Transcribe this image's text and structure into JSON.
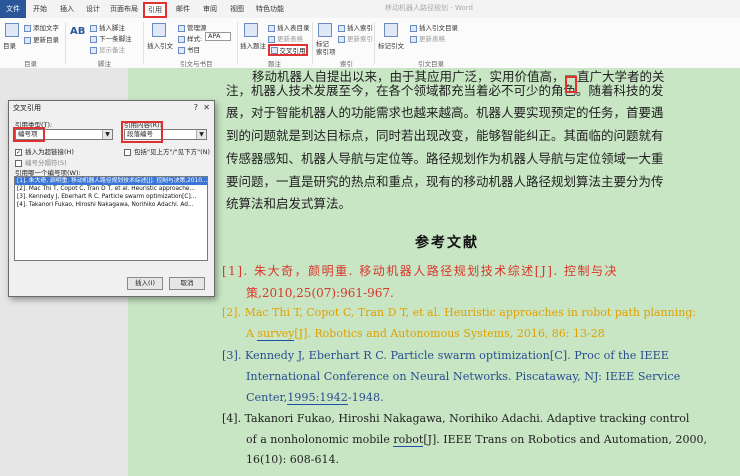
{
  "tabs": {
    "file": "文件",
    "home": "开始",
    "insert": "插入",
    "design": "设计",
    "layout": "页面布局",
    "references": "引用",
    "mailings": "邮件",
    "review": "审阅",
    "view": "视图",
    "special": "特色功能"
  },
  "window_title": "移动机器人路径规划 - Word",
  "ribbon": {
    "toc_label": "目录",
    "add_text": "添加文字",
    "update_toc": "更新目录",
    "insert_footnote": "插入脚注",
    "next_footnote": "下一条脚注",
    "show_notes": "显示备注",
    "ab_label": "AB",
    "insert_citation": "插入引文",
    "manage_sources": "管理源",
    "style_label": "样式:",
    "style_value": "APA",
    "bibliography": "书目",
    "insert_caption": "插入题注",
    "insert_table_of_figures": "插入表目录",
    "update_table": "更新表格",
    "cross_reference": "交叉引用",
    "mark_entry": "标记\n索引项",
    "insert_index": "插入索引",
    "update_index": "更新索引",
    "mark_citation": "标记引文",
    "insert_toa": "插入引文目录",
    "update_toa": "更新表格",
    "group_toc": "目录",
    "group_footnotes": "脚注",
    "group_citations": "引文与书目",
    "group_captions": "题注",
    "group_index": "索引",
    "group_toa": "引文目录"
  },
  "document": {
    "body_lines": [
      "移动机器人自提出以来，由于其应用广泛，实用价值高，一直广大学者的关",
      "注，机器人技术发展至今，在各个领域都充当着必不可少的角色。随着科技的发",
      "展，对于智能机器人的功能需求也越来越高。机器人要实现预定的任务，首要遇",
      "到的问题就是到达目标点，同时若出现改变，能够智能纠正。其面临的问题就有",
      "传感器感知、机器人导航与定位等。路径规划作为机器人导航与定位领域一大重",
      "要问题，一直是研究的热点和重点，现有的移动机器人路径规划算法主要分为传",
      "统算法和启发式算法。"
    ],
    "references_title": "参考文献",
    "refs": [
      {
        "line1": "[1]. 朱大奇，颜明重. 移动机器人路径规划技术综述[J]. 控制与决",
        "line2": "策,2010,25(07):961-967."
      },
      {
        "line1": "[2]. Mac Thi T, Copot C, Tran D T, et al. Heuristic approaches in robot path planning:",
        "line2a": "A ",
        "line2b": "survey",
        "line2c": "[J]. Robotics and Autonomous Systems, 2016, 86: 13-28"
      },
      {
        "line1": "[3]. Kennedy J, Eberhart R C. Particle swarm optimization[C]. Proc of the IEEE",
        "line2": "International Conference on Neural Networks. Piscataway, NJ: IEEE Service",
        "line3a": "Center,",
        "line3b": "1995:1942",
        "line3c": "-1948."
      },
      {
        "line1": "[4]. Takanori Fukao, Hiroshi Nakagawa, Norihiko Adachi. Adaptive tracking control",
        "line2a": "of a nonholonomic mobile ",
        "line2b": "robot",
        "line2c": "[J]. IEEE Trans on Robotics and Automation, 2000,",
        "line3": "16(10): 608-614."
      }
    ]
  },
  "dialog": {
    "title": "交叉引用",
    "help": "?",
    "close": "✕",
    "ref_type_label": "引用类型(T):",
    "ref_type_value": "编号项",
    "ref_content_label": "引用内容(R):",
    "ref_content_value": "段落编号",
    "insert_hyperlink": "插入为超链接(H)",
    "include_above_below": "包括\"见上方\"/\"见下方\"(N)",
    "separate_numbers": "编号分隔符(S)",
    "which_item_label": "引用哪一个编号项(W):",
    "items": [
      "[1]. 朱大奇, 颜明重. 移动机器人路径规划技术综述[J]. 控制与决策,2010...",
      "[2]. Mac Thi T, Copot C, Tran D T, et al. Heuristic approache...",
      "[3]. Kennedy J, Eberhart R C. Particle swarm optimization[C]...",
      "[4]. Takanori Fukao, Hiroshi Nakagawa, Norihiko Adachi. Ad..."
    ],
    "insert_button": "插入(I)",
    "cancel_button": "取消"
  }
}
